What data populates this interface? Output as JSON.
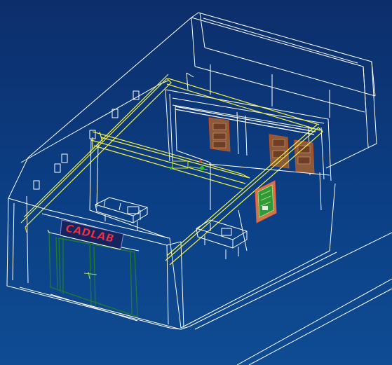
{
  "scene": {
    "sign_text": "CADLAB",
    "colors": {
      "background_top": "#0d2e6b",
      "background_bottom": "#0f4c93",
      "wireframe": "#ffffff",
      "crane_rail": "#f2f24a",
      "entrance_frame": "#1f7a2c",
      "doors": "#8a5a3b",
      "sign_text": "#ff3030",
      "panel": "#2e9a3a"
    }
  }
}
